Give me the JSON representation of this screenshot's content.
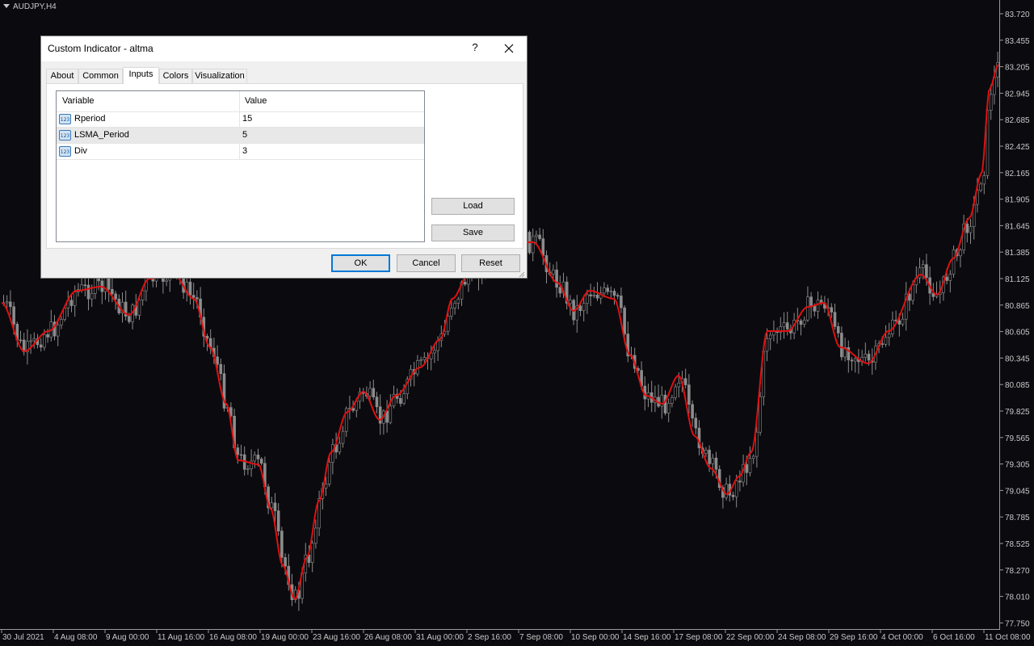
{
  "chart": {
    "symbol": "AUDJPY,H4",
    "background": "#0b0b0f",
    "candle_color": "#8c8c8c",
    "ma_color": "#e01010",
    "price_axis": [
      "83.720",
      "83.455",
      "83.205",
      "82.945",
      "82.685",
      "82.425",
      "82.165",
      "81.905",
      "81.645",
      "81.385",
      "81.125",
      "80.865",
      "80.605",
      "80.345",
      "80.085",
      "79.825",
      "79.565",
      "79.305",
      "79.045",
      "78.785",
      "78.525",
      "78.270",
      "78.010",
      "77.750"
    ],
    "time_axis": [
      "30 Jul 2021",
      "4 Aug 08:00",
      "9 Aug 00:00",
      "11 Aug 16:00",
      "16 Aug 08:00",
      "19 Aug 00:00",
      "23 Aug 16:00",
      "26 Aug 08:00",
      "31 Aug 00:00",
      "2 Sep 16:00",
      "7 Sep 08:00",
      "10 Sep 00:00",
      "14 Sep 16:00",
      "17 Sep 08:00",
      "22 Sep 00:00",
      "24 Sep 08:00",
      "29 Sep 16:00",
      "4 Oct 00:00",
      "6 Oct 16:00",
      "11 Oct 08:00"
    ]
  },
  "dialog": {
    "title": "Custom Indicator - altma",
    "help": "?",
    "tabs": [
      {
        "label": "About"
      },
      {
        "label": "Common"
      },
      {
        "label": "Inputs"
      },
      {
        "label": "Colors"
      },
      {
        "label": "Visualization"
      }
    ],
    "active_tab": "Inputs",
    "columns": {
      "variable": "Variable",
      "value": "Value"
    },
    "rows": [
      {
        "name": "Rperiod",
        "value": "15",
        "icon": "numeric-123-icon"
      },
      {
        "name": "LSMA_Period",
        "value": "5",
        "icon": "numeric-123-icon"
      },
      {
        "name": "Div",
        "value": "3",
        "icon": "numeric-123-icon"
      }
    ],
    "buttons": {
      "load": "Load",
      "save": "Save",
      "ok": "OK",
      "cancel": "Cancel",
      "reset": "Reset"
    }
  }
}
